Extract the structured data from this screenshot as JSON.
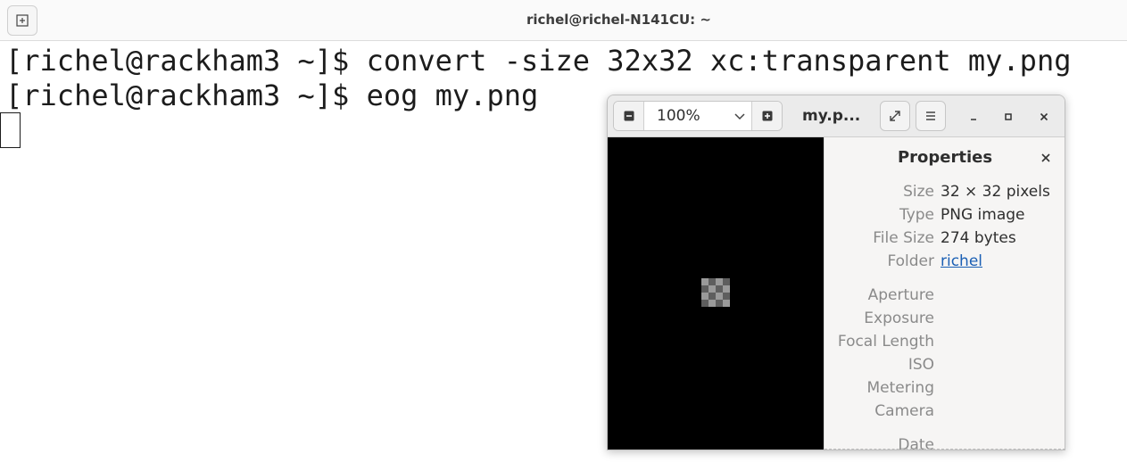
{
  "terminal": {
    "title": "richel@richel-N141CU: ~",
    "lines": [
      "[richel@rackham3 ~]$ convert -size 32x32 xc:transparent my.png",
      "[richel@rackham3 ~]$ eog my.png"
    ]
  },
  "viewer": {
    "zoom_value": "100%",
    "title": "my.p...",
    "properties": {
      "heading": "Properties",
      "rows": [
        {
          "label": "Size",
          "value": "32 × 32 pixels"
        },
        {
          "label": "Type",
          "value": "PNG image"
        },
        {
          "label": "File Size",
          "value": "274 bytes"
        },
        {
          "label": "Folder",
          "value": "richel"
        },
        {
          "label": "Aperture",
          "value": ""
        },
        {
          "label": "Exposure",
          "value": ""
        },
        {
          "label": "Focal Length",
          "value": ""
        },
        {
          "label": "ISO",
          "value": ""
        },
        {
          "label": "Metering",
          "value": ""
        },
        {
          "label": "Camera",
          "value": ""
        },
        {
          "label": "Date",
          "value": ""
        }
      ]
    }
  },
  "icons": {
    "new_tab": "new-tab-icon",
    "zoom_out": "zoom-out-icon",
    "zoom_in": "zoom-in-icon",
    "dropdown": "chevron-down-icon",
    "fullscreen": "fullscreen-icon",
    "menu": "hamburger-menu-icon",
    "minimize": "minimize-icon",
    "maximize": "maximize-icon",
    "close": "close-icon"
  },
  "colors": {
    "link": "#1a5fb4",
    "canvas_background": "#000000"
  }
}
